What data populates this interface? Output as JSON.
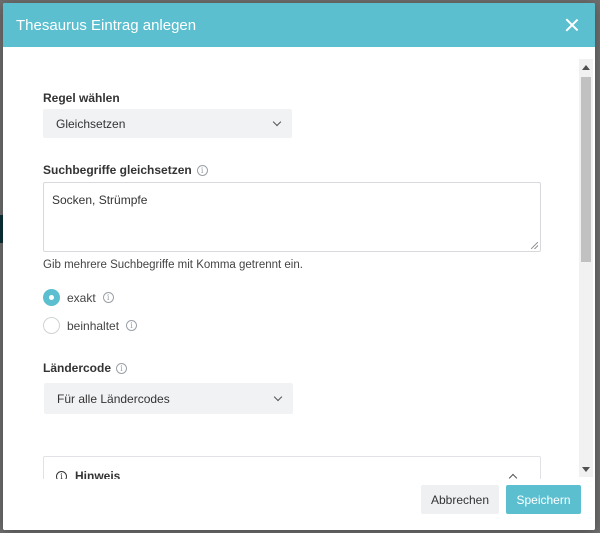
{
  "modal": {
    "title": "Thesaurus Eintrag anlegen"
  },
  "rule": {
    "label": "Regel wählen",
    "selected": "Gleichsetzen"
  },
  "search_terms": {
    "label": "Suchbegriffe gleichsetzen",
    "value": "Socken, Strümpfe",
    "helper": "Gib mehrere Suchbegriffe mit Komma getrennt ein."
  },
  "match_mode": {
    "options": [
      {
        "label": "exakt",
        "checked": true
      },
      {
        "label": "beinhaltet",
        "checked": false
      }
    ]
  },
  "country_code": {
    "label": "Ländercode",
    "selected": "Für alle Ländercodes"
  },
  "hint": {
    "title": "Hinweis"
  },
  "footer": {
    "cancel_label": "Abbrechen",
    "save_label": "Speichern"
  },
  "colors": {
    "accent": "#5bbfcf"
  }
}
